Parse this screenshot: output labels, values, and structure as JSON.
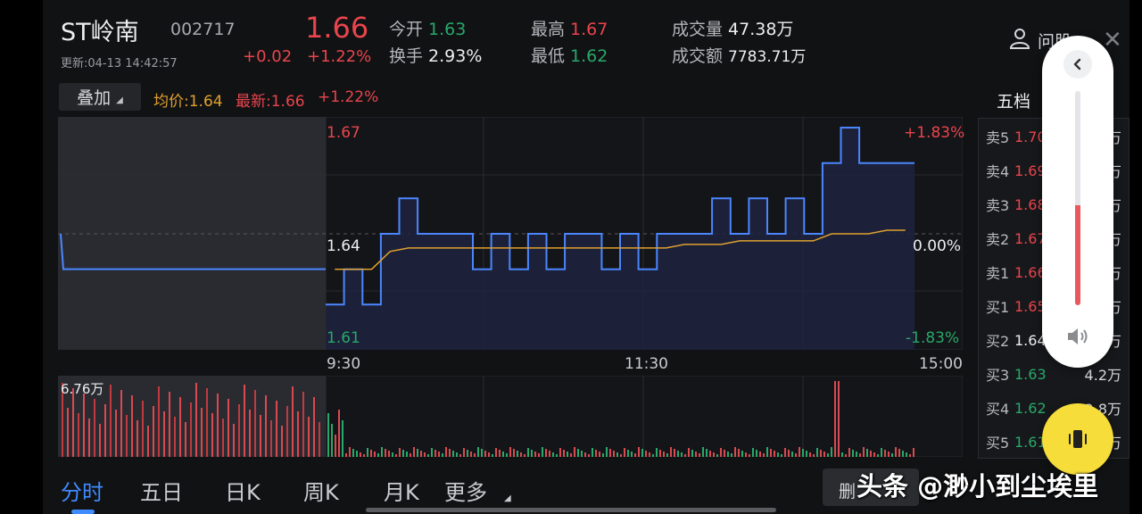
{
  "header": {
    "name": "ST岭南",
    "code": "002717",
    "update_time": "更新:04-13 14:42:57",
    "price": "1.66",
    "change": "+0.02",
    "change_pct": "+1.22%",
    "open_label": "今开",
    "open": "1.63",
    "turnover_label": "换手",
    "turnover": "2.93%",
    "high_label": "最高",
    "high": "1.67",
    "low_label": "最低",
    "low": "1.62",
    "volume_label": "成交量",
    "volume": "47.38万",
    "amount_label": "成交额",
    "amount": "7783.71万"
  },
  "toolbar": {
    "overlay": "叠加",
    "avg": "均价:1.64",
    "latest": "最新:1.66",
    "latest_pct": "+1.22%"
  },
  "axis": {
    "price_top": "1.67",
    "price_mid": "1.64",
    "price_bottom": "1.61",
    "pct_top": "+1.83%",
    "pct_mid": "0.00%",
    "pct_bottom": "-1.83%",
    "vol_max": "6.76万",
    "time_start": "9:30",
    "time_mid": "11:30",
    "time_end": "15:00"
  },
  "order_book": {
    "title": "五档",
    "rows": [
      {
        "label": "卖5",
        "price": "1.70",
        "volume": "万"
      },
      {
        "label": "卖4",
        "price": "1.69",
        "volume": "万"
      },
      {
        "label": "卖3",
        "price": "1.68",
        "volume": "万"
      },
      {
        "label": "卖2",
        "price": "1.67",
        "volume": "万"
      },
      {
        "label": "卖1",
        "price": "1.66",
        "volume": "万"
      },
      {
        "label": "买1",
        "price": "1.65",
        "volume": "万"
      },
      {
        "label": "买2",
        "price": "1.64",
        "volume": "万"
      },
      {
        "label": "买3",
        "price": "1.63",
        "volume": "4.2万"
      },
      {
        "label": "买4",
        "price": "1.62",
        "volume": "2.8万"
      },
      {
        "label": "买5",
        "price": "1.61",
        "volume": "万"
      }
    ]
  },
  "right_top": {
    "qa": "问股"
  },
  "tabs": [
    "分时",
    "五日",
    "日K",
    "周K",
    "月K",
    "更多"
  ],
  "bottom": {
    "delete": "删",
    "watermark": "头条 @渺小到尘埃里"
  },
  "colors": {
    "up": "#e8454d",
    "down": "#28a86a",
    "price_line": "#4b86ff",
    "avg_line": "#e0a030",
    "accent": "#3f8bff"
  },
  "chart_data": {
    "type": "line",
    "x_labels": [
      "9:30",
      "11:30",
      "15:00"
    ],
    "ylim": [
      1.61,
      1.67
    ],
    "reference_price": 1.64,
    "series": [
      {
        "name": "最新",
        "values": [
          1.62,
          1.63,
          1.62,
          1.64,
          1.65,
          1.64,
          1.64,
          1.64,
          1.63,
          1.64,
          1.63,
          1.64,
          1.63,
          1.64,
          1.64,
          1.63,
          1.64,
          1.63,
          1.64,
          1.64,
          1.64,
          1.65,
          1.64,
          1.65,
          1.64,
          1.65,
          1.64,
          1.66,
          1.67,
          1.66,
          1.66,
          1.66
        ]
      },
      {
        "name": "均价",
        "values": [
          1.63,
          1.63,
          1.63,
          1.635,
          1.636,
          1.636,
          1.636,
          1.636,
          1.636,
          1.636,
          1.636,
          1.636,
          1.636,
          1.636,
          1.636,
          1.636,
          1.636,
          1.636,
          1.636,
          1.637,
          1.637,
          1.637,
          1.638,
          1.638,
          1.638,
          1.638,
          1.638,
          1.64,
          1.64,
          1.64,
          1.641,
          1.641
        ]
      }
    ]
  }
}
